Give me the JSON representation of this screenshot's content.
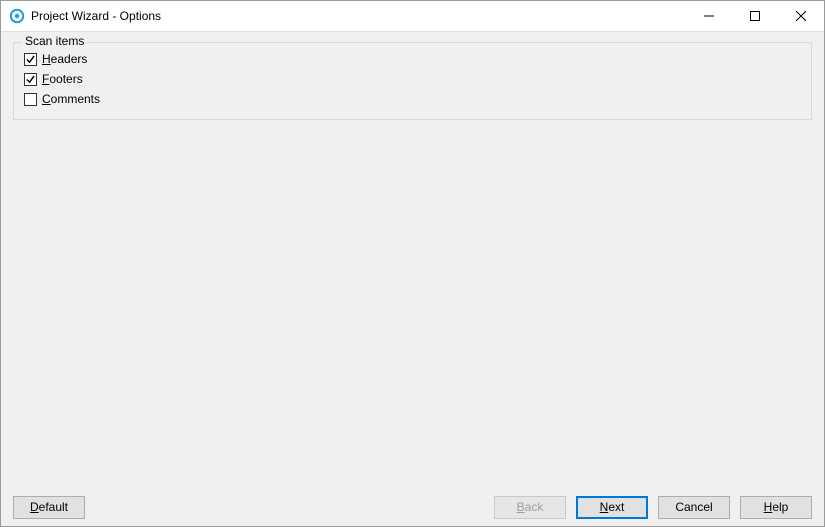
{
  "window": {
    "title": "Project Wizard - Options"
  },
  "group": {
    "legend": "Scan items",
    "headers_label": "Headers",
    "headers_accel_index": 0,
    "headers_checked": true,
    "footers_label": "Footers",
    "footers_accel_index": 0,
    "footers_checked": true,
    "comments_label": "Comments",
    "comments_accel_index": 0,
    "comments_checked": false
  },
  "buttons": {
    "default_label": "Default",
    "default_accel_index": 0,
    "back_label": "Back",
    "back_accel_index": 0,
    "back_enabled": false,
    "next_label": "Next",
    "next_accel_index": 0,
    "next_primary": true,
    "cancel_label": "Cancel",
    "help_label": "Help",
    "help_accel_index": 0
  }
}
